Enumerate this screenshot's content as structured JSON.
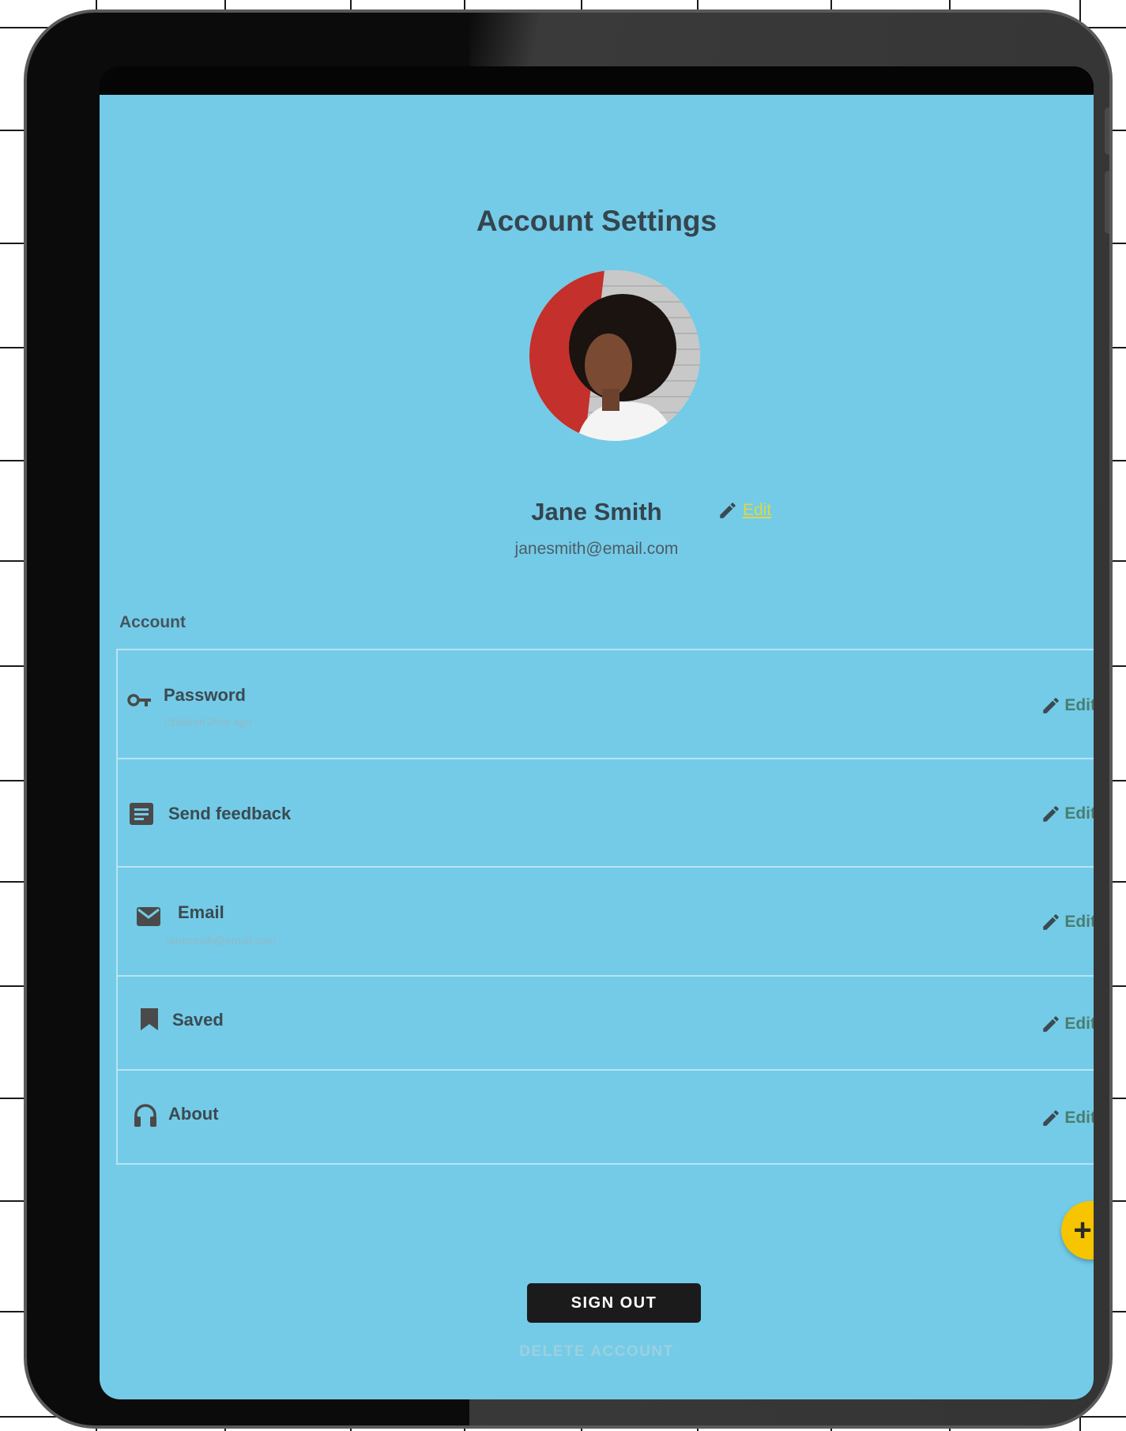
{
  "colors": {
    "screen_background": "#74cbe7",
    "text_primary": "#34454f",
    "profile_edit_link": "#d9d94a",
    "row_edit": "#4a7d70",
    "fab": "#f7c400",
    "sign_out_bg": "#1b1b1b",
    "divider": "#b8e4f2"
  },
  "page": {
    "title": "Account Settings"
  },
  "profile": {
    "name": "Jane Smith",
    "edit_label": "Edit",
    "edit_icon": "pencil-icon",
    "email": "janesmith@email.com",
    "avatar": "profile-photo"
  },
  "section": {
    "label": "Account"
  },
  "rows": [
    {
      "title": "Password",
      "subtitle": "Updated 2hrs ago",
      "icon": "key-icon",
      "edit_label": "Edit"
    },
    {
      "title": "Send feedback",
      "subtitle": "",
      "icon": "message-icon",
      "edit_label": "Edit"
    },
    {
      "title": "Email",
      "subtitle": "janesmith@email.com",
      "icon": "mail-icon",
      "edit_label": "Edit"
    },
    {
      "title": "Saved",
      "subtitle": "",
      "icon": "bookmark-icon",
      "edit_label": "Edit"
    },
    {
      "title": "About",
      "subtitle": "",
      "icon": "headphones-icon",
      "edit_label": "Edit"
    }
  ],
  "fab": {
    "icon": "plus-icon",
    "glyph": "+"
  },
  "actions": {
    "sign_out": "SIGN OUT",
    "delete_account": "DELETE ACCOUNT"
  }
}
